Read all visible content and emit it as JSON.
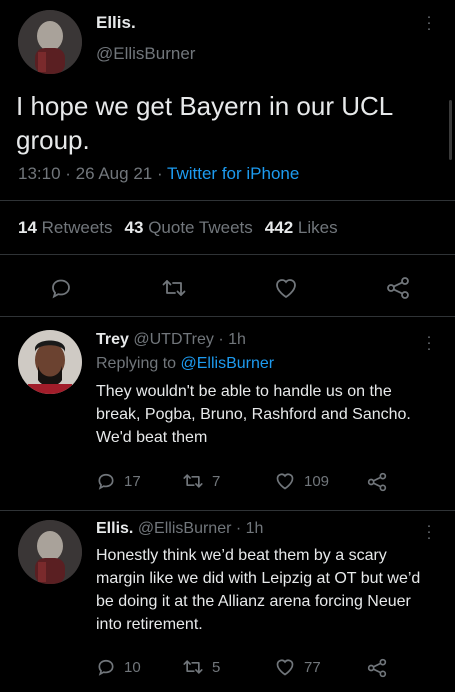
{
  "main_tweet": {
    "author_name": "Ellis.",
    "author_handle": "@EllisBurner",
    "text": "I hope we get Bayern in our UCL group.",
    "timestamp": "13:10 · 26 Aug 21 · ",
    "source": "Twitter for iPhone",
    "stats": {
      "retweets_count": "14",
      "retweets_label": "Retweets",
      "quotes_count": "43",
      "quotes_label": "Quote Tweets",
      "likes_count": "442",
      "likes_label": "Likes"
    }
  },
  "reply1": {
    "name": "Trey",
    "handle": "@UTDTrey · 1h",
    "replying_prefix": "Replying to ",
    "replying_to": "@EllisBurner",
    "text": "They wouldn't be able to handle us on the break, Pogba, Bruno, Rashford and Sancho. We'd beat them",
    "replies": "17",
    "retweets": "7",
    "likes": "109"
  },
  "reply2": {
    "name": "Ellis.",
    "handle": "@EllisBurner · 1h",
    "text": "Honestly think we’d beat them by a scary margin like we did with Leipzig at OT but we’d be doing it at the Allianz arena forcing Neuer into retirement.",
    "replies": "10",
    "retweets": "5",
    "likes": "77"
  },
  "icons": [
    "reply-icon",
    "retweet-icon",
    "like-icon",
    "share-icon",
    "more-icon"
  ],
  "colors": {
    "background": "#000000",
    "accent": "#1d9bf0",
    "muted": "#71767b",
    "text": "#e7e9ea"
  }
}
